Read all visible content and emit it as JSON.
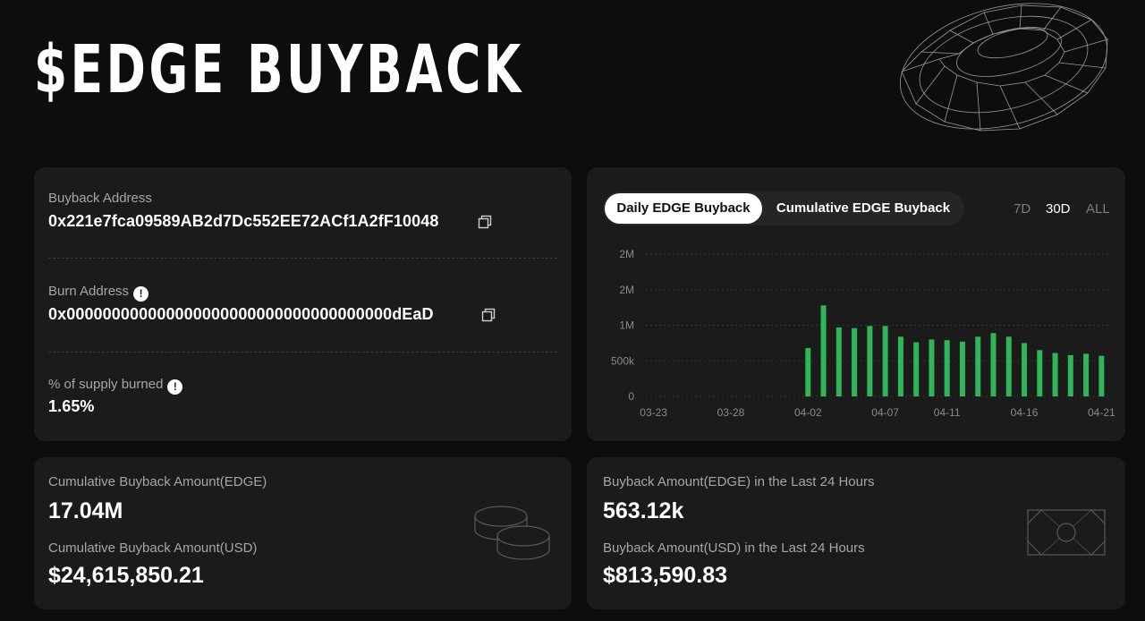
{
  "header": {
    "title": "$EDGE BUYBACK"
  },
  "addresses": {
    "buyback_label": "Buyback Address",
    "buyback_address": "0x221e7fca09589AB2d7Dc552EE72ACf1A2fF10048",
    "burn_label": "Burn Address",
    "burn_address": "0x000000000000000000000000000000000000dEaD",
    "supply_label": "% of supply burned",
    "supply_value": "1.65%",
    "info_glyph": "!"
  },
  "chart_panel": {
    "tabs": [
      {
        "label": "Daily EDGE Buyback",
        "active": true
      },
      {
        "label": "Cumulative EDGE Buyback",
        "active": false
      }
    ],
    "ranges": [
      {
        "label": "7D",
        "active": false
      },
      {
        "label": "30D",
        "active": true
      },
      {
        "label": "ALL",
        "active": false
      }
    ]
  },
  "chart_data": {
    "type": "bar",
    "title": "",
    "xlabel": "",
    "ylabel": "",
    "bar_color": "#2fb55a",
    "y_ticks": [
      {
        "label": "2M",
        "value": 2000000
      },
      {
        "label": "2M",
        "value": 1500000
      },
      {
        "label": "1M",
        "value": 1000000
      },
      {
        "label": "500k",
        "value": 500000
      },
      {
        "label": "0",
        "value": 0
      }
    ],
    "ylim": [
      0,
      2000000
    ],
    "x_tick_labels": [
      "03-23",
      "03-28",
      "04-02",
      "04-07",
      "04-11",
      "04-16",
      "04-21"
    ],
    "categories": [
      "03-23",
      "03-24",
      "03-25",
      "03-26",
      "03-27",
      "03-28",
      "03-29",
      "03-30",
      "03-31",
      "04-01",
      "04-02",
      "04-03",
      "04-04",
      "04-05",
      "04-06",
      "04-07",
      "04-08",
      "04-09",
      "04-10",
      "04-11",
      "04-12",
      "04-13",
      "04-14",
      "04-15",
      "04-16",
      "04-17",
      "04-18",
      "04-19",
      "04-20",
      "04-21"
    ],
    "values": [
      0,
      0,
      0,
      0,
      0,
      0,
      0,
      0,
      0,
      0,
      680000,
      1280000,
      970000,
      960000,
      990000,
      990000,
      840000,
      760000,
      800000,
      790000,
      770000,
      840000,
      890000,
      840000,
      750000,
      650000,
      610000,
      580000,
      600000,
      570000
    ],
    "grid": true
  },
  "cumulative": {
    "edge_label": "Cumulative Buyback Amount(EDGE)",
    "edge_value": "17.04M",
    "usd_label": "Cumulative Buyback Amount(USD)",
    "usd_value": "$24,615,850.21"
  },
  "last24h": {
    "edge_label": "Buyback Amount(EDGE) in the Last 24 Hours",
    "edge_value": "563.12k",
    "usd_label": "Buyback Amount(USD) in the Last 24 Hours",
    "usd_value": "$813,590.83"
  }
}
